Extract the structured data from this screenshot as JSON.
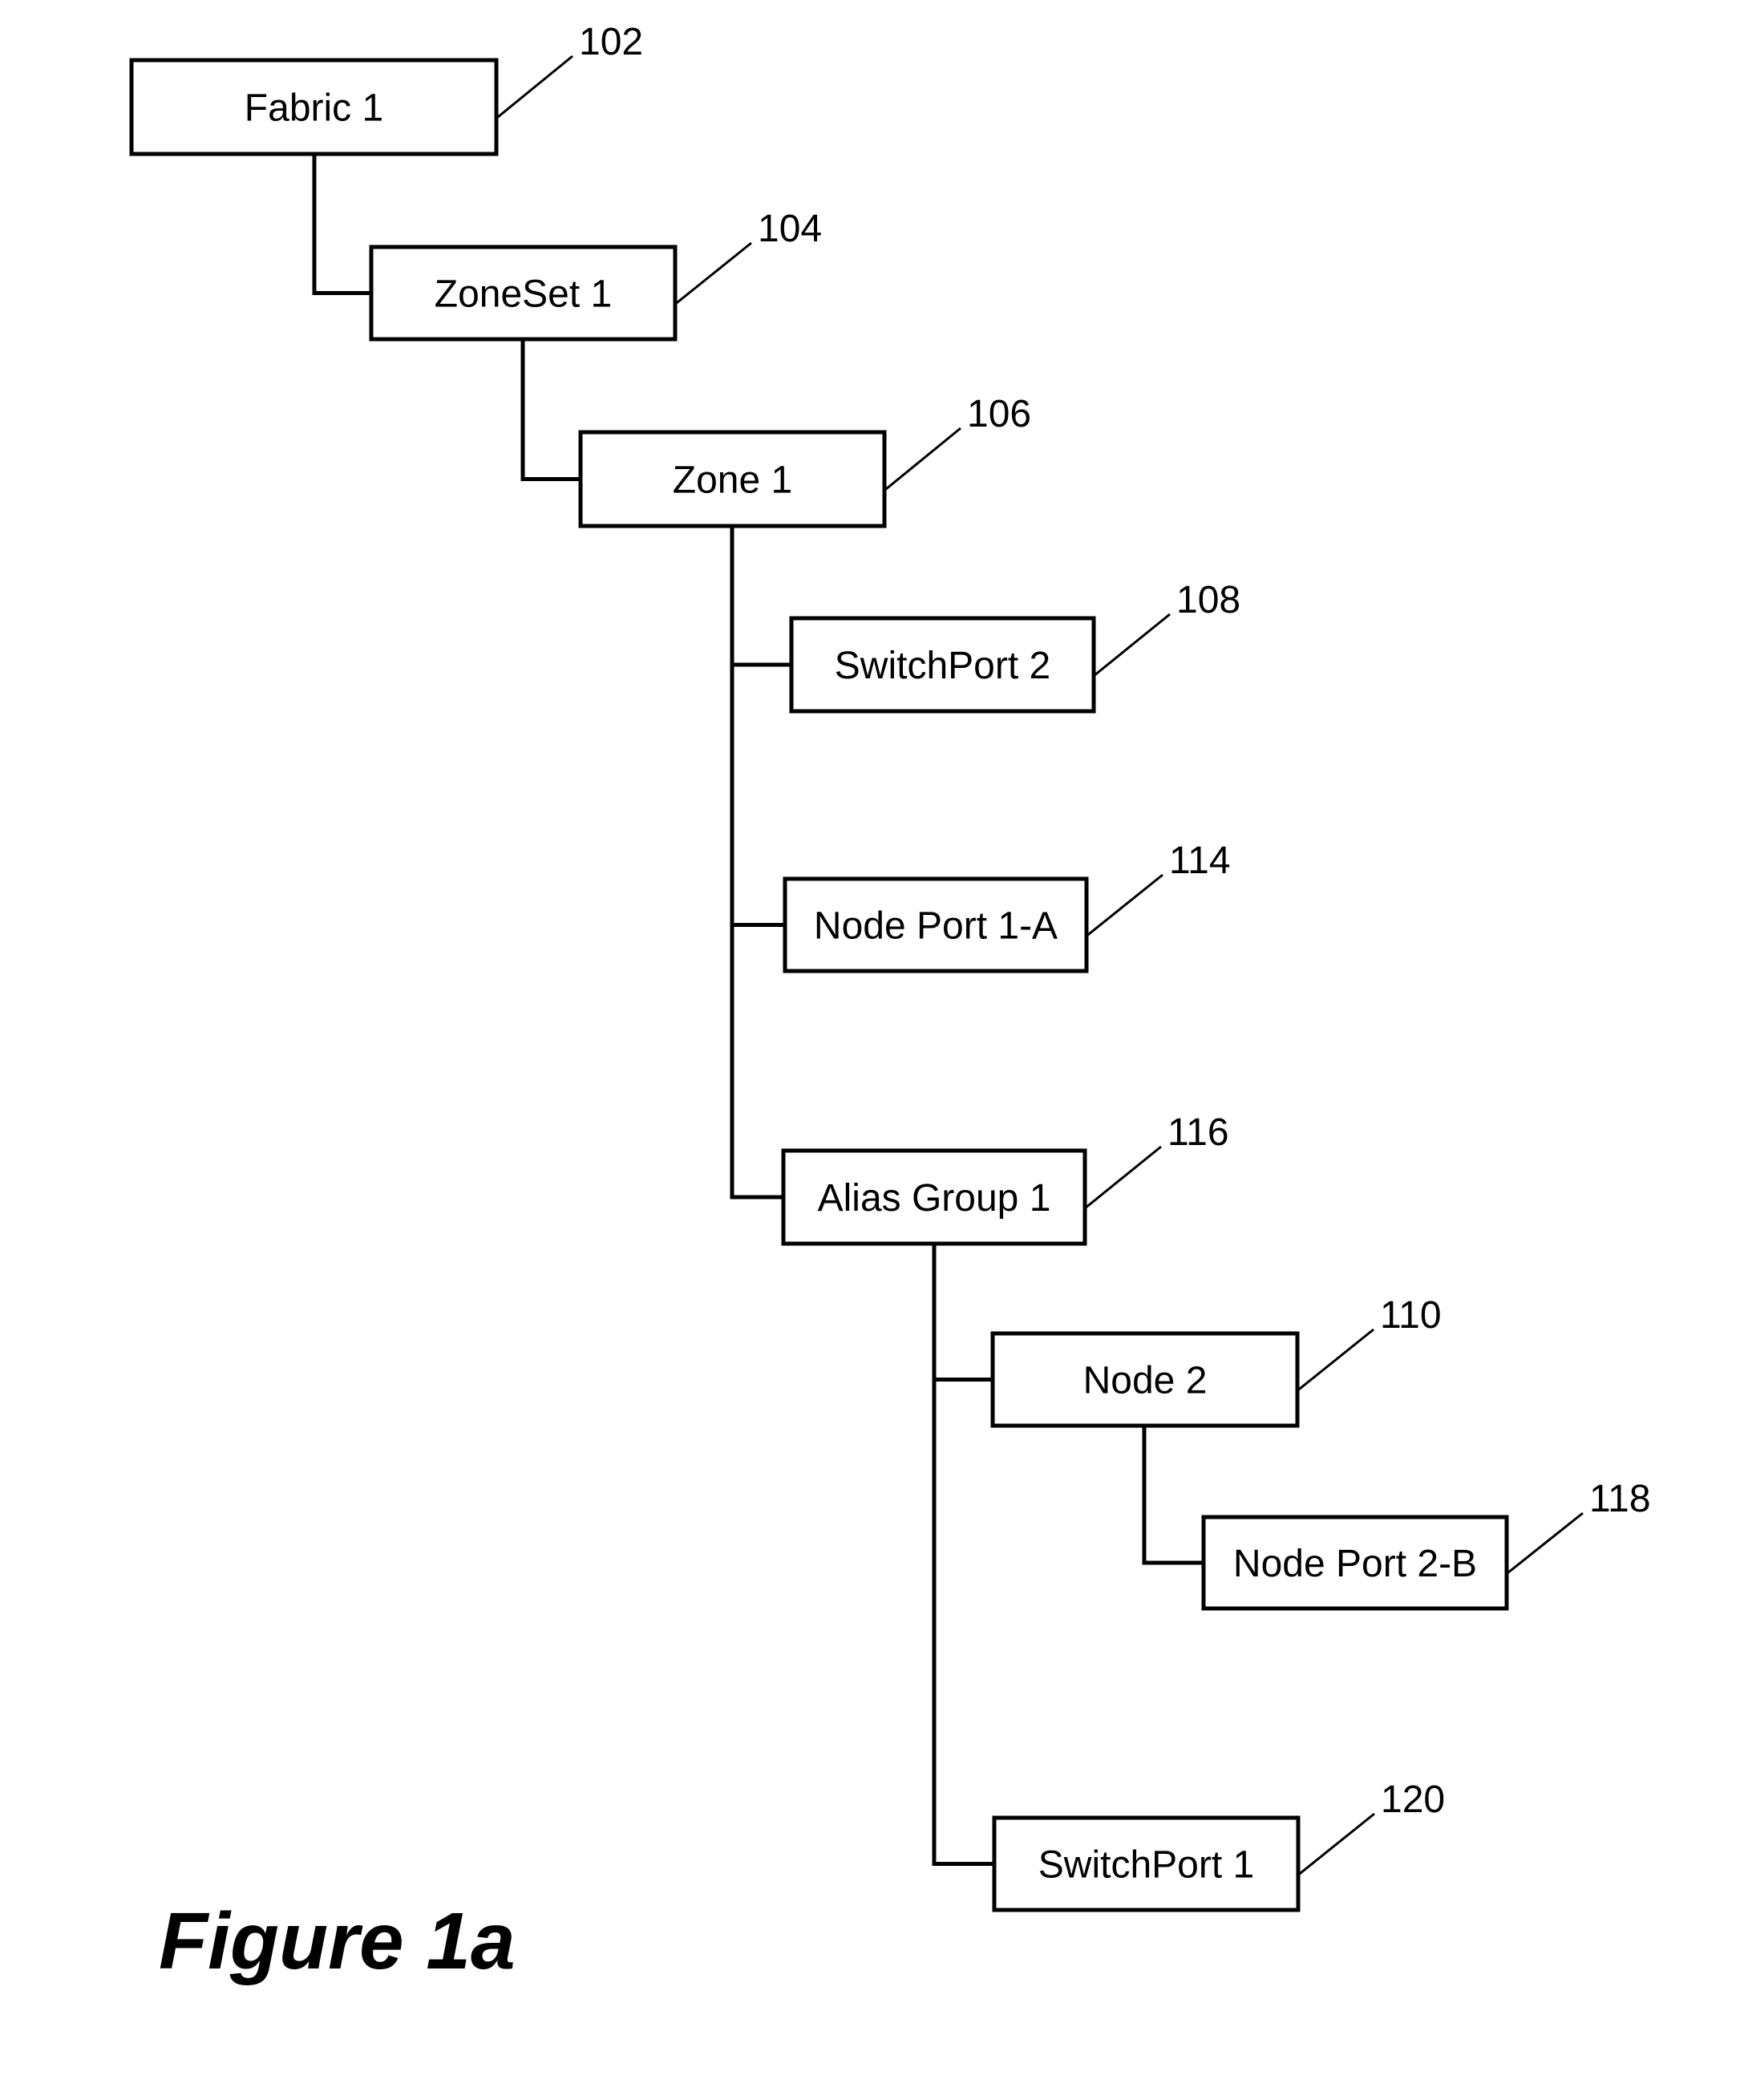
{
  "figure": {
    "caption": "Figure 1a",
    "nodes": [
      {
        "id": "fabric-1",
        "label": "Fabric 1",
        "ref": "102",
        "parent": null
      },
      {
        "id": "zoneset-1",
        "label": "ZoneSet 1",
        "ref": "104",
        "parent": "fabric-1"
      },
      {
        "id": "zone-1",
        "label": "Zone 1",
        "ref": "106",
        "parent": "zoneset-1"
      },
      {
        "id": "switchport-2",
        "label": "SwitchPort 2",
        "ref": "108",
        "parent": "zone-1"
      },
      {
        "id": "node-port-1a",
        "label": "Node Port 1-A",
        "ref": "114",
        "parent": "zone-1"
      },
      {
        "id": "alias-group-1",
        "label": "Alias Group 1",
        "ref": "116",
        "parent": "zone-1"
      },
      {
        "id": "node-2",
        "label": "Node 2",
        "ref": "110",
        "parent": "alias-group-1"
      },
      {
        "id": "node-port-2b",
        "label": "Node Port 2-B",
        "ref": "118",
        "parent": "node-2"
      },
      {
        "id": "switchport-1",
        "label": "SwitchPort 1",
        "ref": "120",
        "parent": "alias-group-1"
      }
    ]
  }
}
